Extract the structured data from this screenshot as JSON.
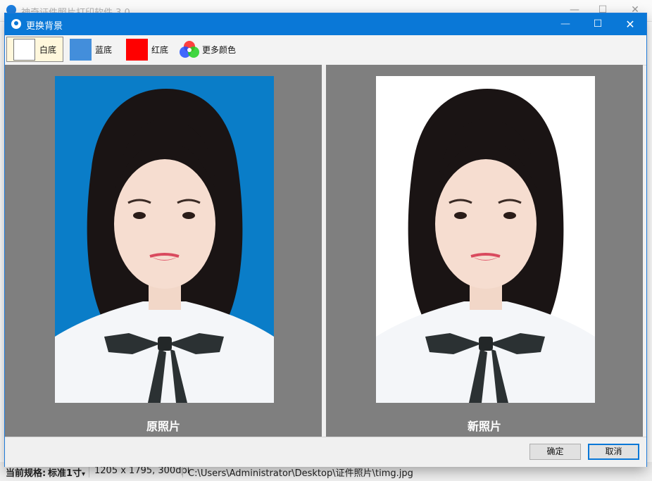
{
  "background_window": {
    "title": "神奇证件照片打印软件 3.0",
    "controls": {
      "minimize": "—",
      "maximize": "☐",
      "close": "✕"
    },
    "status_bar": {
      "spec_label": "当前规格:",
      "spec_value": "标准1寸",
      "dropdown_glyph": "▾",
      "resolution": "1205 x 1795, 300dpi",
      "file_path": "C:\\Users\\Administrator\\Desktop\\证件照片\\timg.jpg"
    }
  },
  "dialog": {
    "title": "更换背景",
    "controls": {
      "minimize": "—",
      "maximize": "☐",
      "close": "✕"
    },
    "toolbar": {
      "options": [
        {
          "label": "白底",
          "color": "#ffffff",
          "selected": true
        },
        {
          "label": "蓝底",
          "color": "#438edb",
          "selected": false
        },
        {
          "label": "红底",
          "color": "#ff0000",
          "selected": false
        },
        {
          "label": "更多颜色",
          "icon": "rgb-color-wheel-icon",
          "selected": false
        }
      ]
    },
    "panels": {
      "original": {
        "caption": "原照片",
        "background_color": "#0a7dc8"
      },
      "new": {
        "caption": "新照片",
        "background_color": "#ffffff"
      }
    },
    "buttons": {
      "ok": "确定",
      "cancel": "取消"
    }
  }
}
